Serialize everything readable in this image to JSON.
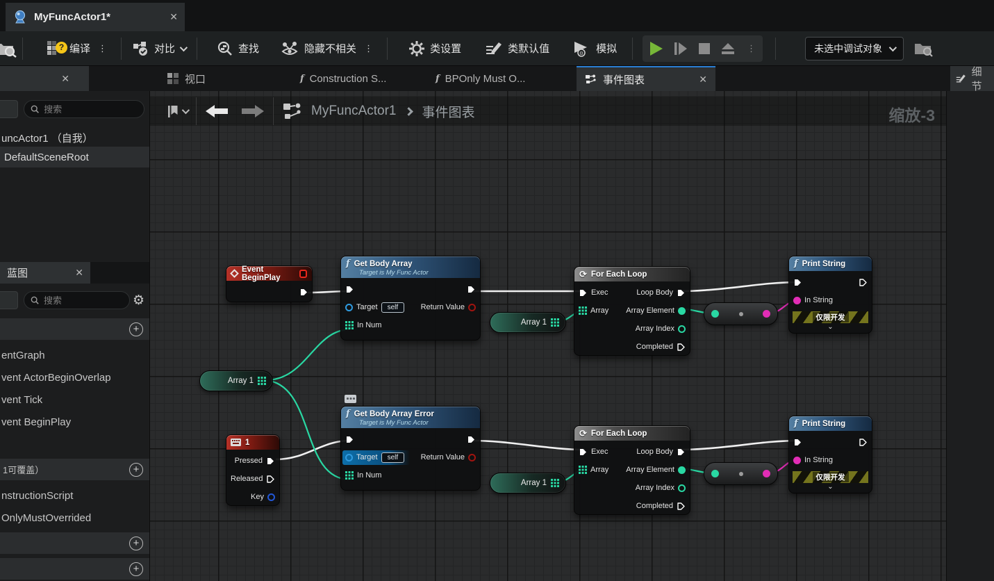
{
  "window": {
    "tab_title": "MyFuncActor1*",
    "close": "✕"
  },
  "toolbar": {
    "compile": "编译",
    "diff": "对比",
    "find": "查找",
    "hide_unrelated": "隐藏不相关",
    "class_settings": "类设置",
    "class_defaults": "类默认值",
    "simulate": "模拟",
    "debug_object": "未选中调试对象"
  },
  "doc_tabs": {
    "viewport": "视口",
    "construction": "Construction S...",
    "bponly": "BPOnly Must O...",
    "event_graph": "事件图表",
    "details": "细节",
    "close": "✕"
  },
  "components_panel": {
    "search_placeholder": "搜索",
    "items": [
      "uncActor1 （自我）",
      "DefaultSceneRoot"
    ]
  },
  "my_blueprint": {
    "tab": "蓝图",
    "search_placeholder": "搜索",
    "graphs": [
      "entGraph",
      "vent ActorBeginOverlap",
      "vent Tick",
      "vent BeginPlay"
    ],
    "functions_header": "1可覆盖）",
    "functions": [
      "nstructionScript",
      "OnlyMustOverrided"
    ]
  },
  "graph": {
    "breadcrumb_root": "MyFuncActor1",
    "breadcrumb_current": "事件图表",
    "zoom_label": "缩放-3"
  },
  "nodes": {
    "event_begin_play": {
      "title": "Event BeginPlay"
    },
    "get_body_array": {
      "title": "Get Body Array",
      "subtitle": "Target is My Func Actor",
      "target_label": "Target",
      "target_value": "self",
      "return_label": "Return Value",
      "in_num_label": "In Num"
    },
    "get_body_array_error": {
      "title": "Get Body Array Error",
      "subtitle": "Target is My Func Actor",
      "target_label": "Target",
      "target_value": "self",
      "return_label": "Return Value",
      "in_num_label": "In Num"
    },
    "foreach": {
      "title": "For Each Loop",
      "exec": "Exec",
      "loop_body": "Loop Body",
      "array": "Array",
      "array_element": "Array Element",
      "array_index": "Array Index",
      "completed": "Completed"
    },
    "print_string": {
      "title": "Print String",
      "in_string": "In String",
      "dev_only": "仅限开发",
      "collapse_chevron": "⌄"
    },
    "key_event": {
      "title": "1",
      "pressed": "Pressed",
      "released": "Released",
      "key": "Key"
    },
    "array_var": {
      "label": "Array 1"
    }
  },
  "colors": {
    "accent_tab": "#2a7fd4",
    "exec_wire": "#f0f0f0",
    "array_green": "#29d8a3",
    "string_magenta": "#e22db6",
    "event_red": "#b53127",
    "function_blue": "#31577c",
    "play_green": "#77b738"
  }
}
